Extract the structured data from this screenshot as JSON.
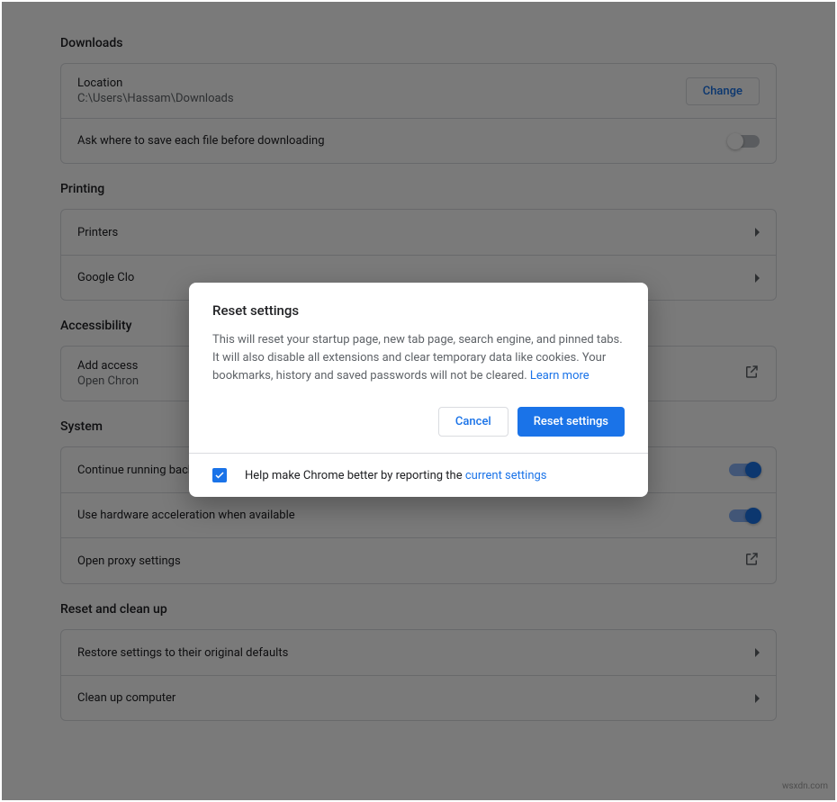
{
  "sections": {
    "downloads": {
      "heading": "Downloads",
      "location_label": "Location",
      "location_path": "C:\\Users\\Hassam\\Downloads",
      "change_button": "Change",
      "ask_where_label": "Ask where to save each file before downloading",
      "ask_where_enabled": false
    },
    "printing": {
      "heading": "Printing",
      "printers_label": "Printers",
      "cloud_print_label": "Google Clo"
    },
    "accessibility": {
      "heading": "Accessibility",
      "add_title": "Add access",
      "add_subtitle": "Open Chron"
    },
    "system": {
      "heading": "System",
      "background_apps_label": "Continue running background apps when Google Chrome is closed",
      "background_apps_enabled": true,
      "hardware_accel_label": "Use hardware acceleration when available",
      "hardware_accel_enabled": true,
      "proxy_label": "Open proxy settings"
    },
    "reset": {
      "heading": "Reset and clean up",
      "restore_label": "Restore settings to their original defaults",
      "cleanup_label": "Clean up computer"
    }
  },
  "dialog": {
    "title": "Reset settings",
    "body_text": "This will reset your startup page, new tab page, search engine, and pinned tabs. It will also disable all extensions and clear temporary data like cookies. Your bookmarks, history and saved passwords will not be cleared. ",
    "learn_more": "Learn more",
    "cancel_label": "Cancel",
    "confirm_label": "Reset settings",
    "help_prefix": "Help make Chrome better by reporting the ",
    "help_link": "current settings",
    "help_checked": true
  },
  "watermark": "wsxdn.com"
}
